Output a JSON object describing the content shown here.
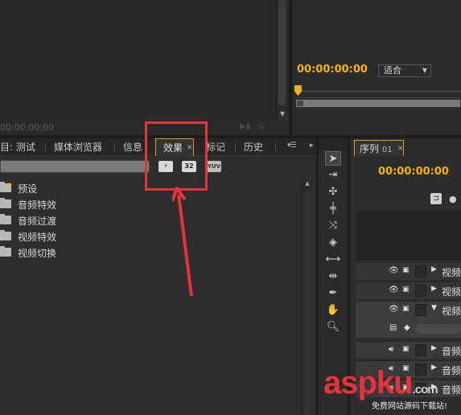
{
  "source_monitor": {
    "timecode": "00:00:00:00"
  },
  "program_monitor": {
    "timecode": "00:00:00:00",
    "fit_label": "适合"
  },
  "project_panel": {
    "tabs": [
      {
        "label": "目: 测试"
      },
      {
        "label": "媒体浏览器"
      },
      {
        "label": "信息"
      },
      {
        "label": "效果"
      },
      {
        "label": "标记"
      },
      {
        "label": "历史"
      }
    ],
    "toolbar": {
      "accel_label": "⚡",
      "bit32_label": "32",
      "yuv_label": "YUV"
    },
    "effects_folders": [
      {
        "label": "预设"
      },
      {
        "label": "音频特效"
      },
      {
        "label": "音频过渡"
      },
      {
        "label": "视频特效"
      },
      {
        "label": "视频切换"
      }
    ]
  },
  "sequence": {
    "tab_label": "序列",
    "tab_number": "01",
    "timecode": "00:00:00:00",
    "tracks": [
      {
        "kind": "video",
        "name": "视频"
      },
      {
        "kind": "video",
        "name": "视频"
      },
      {
        "kind": "video",
        "name": "视频"
      },
      {
        "kind": "audio",
        "name": "音频"
      },
      {
        "kind": "audio",
        "name": "音频"
      },
      {
        "kind": "audio",
        "name": "音频"
      }
    ]
  },
  "watermark": {
    "brand": "aspku",
    "tld": ".com",
    "tagline": "免费网站源码下载站!"
  },
  "colors": {
    "accent_timecode": "#f2b400",
    "annotation_red": "#e9323c",
    "panel_bg": "#2e2e2e"
  }
}
